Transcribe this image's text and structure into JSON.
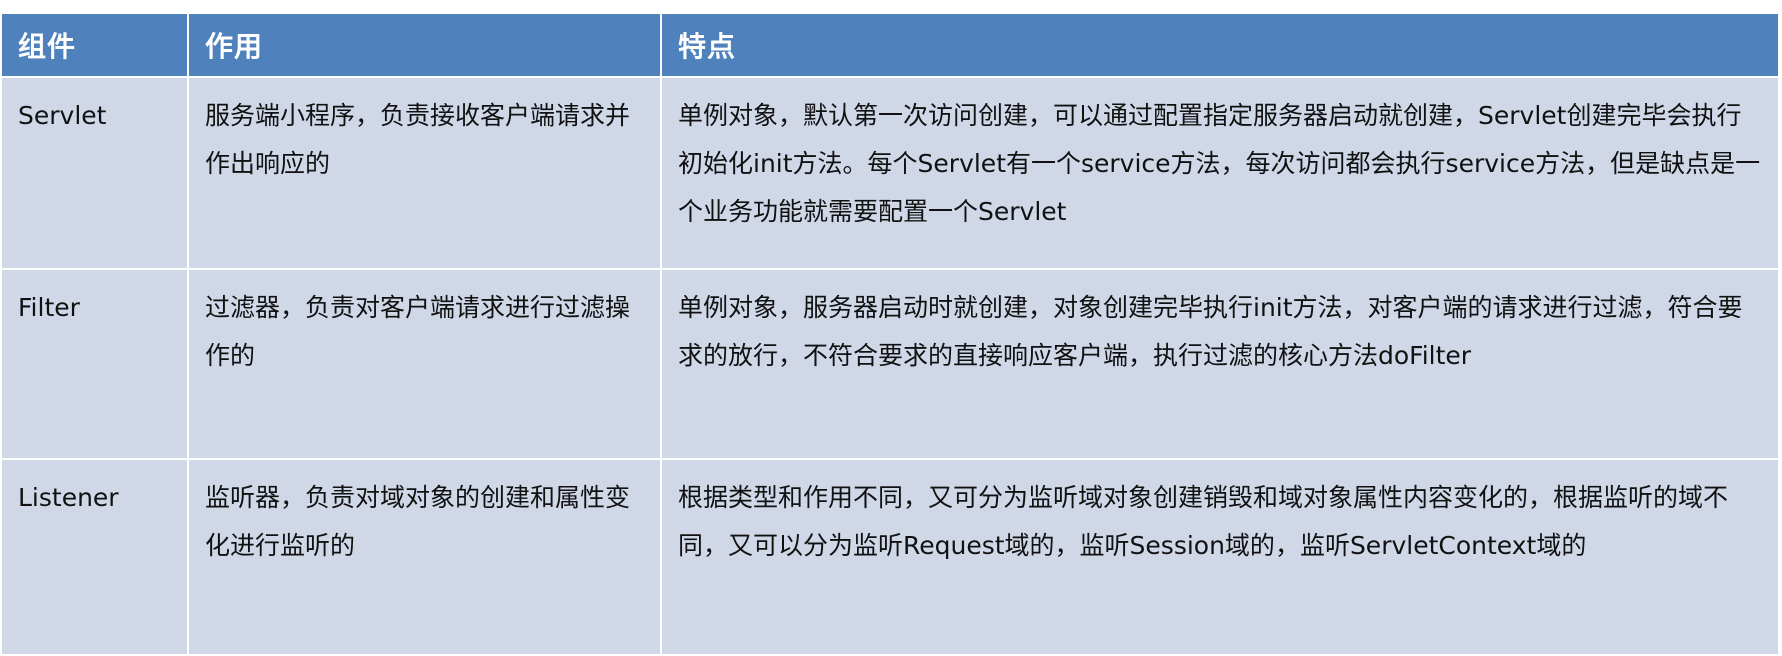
{
  "table": {
    "headers": [
      "组件",
      "作用",
      "特点"
    ],
    "rows": [
      {
        "component": "Servlet",
        "role": "服务端小程序，负责接收客户端请求并作出响应的",
        "features": "单例对象，默认第一次访问创建，可以通过配置指定服务器启动就创建，Servlet创建完毕会执行初始化init方法。每个Servlet有一个service方法，每次访问都会执行service方法，但是缺点是一个业务功能就需要配置一个Servlet"
      },
      {
        "component": "Filter",
        "role": "过滤器，负责对客户端请求进行过滤操作的",
        "features": "单例对象，服务器启动时就创建，对象创建完毕执行init方法，对客户端的请求进行过滤，符合要求的放行，不符合要求的直接响应客户端，执行过滤的核心方法doFilter"
      },
      {
        "component": "Listener",
        "role": "监听器，负责对域对象的创建和属性变化进行监听的",
        "features": "根据类型和作用不同，又可分为监听域对象创建销毁和域对象属性内容变化的，根据监听的域不同，又可以分为监听Request域的，监听Session域的，监听ServletContext域的"
      }
    ]
  },
  "colors": {
    "header_bg": "#4f81bd",
    "cell_bg": "#d0d8e8",
    "header_text": "#ffffff"
  }
}
